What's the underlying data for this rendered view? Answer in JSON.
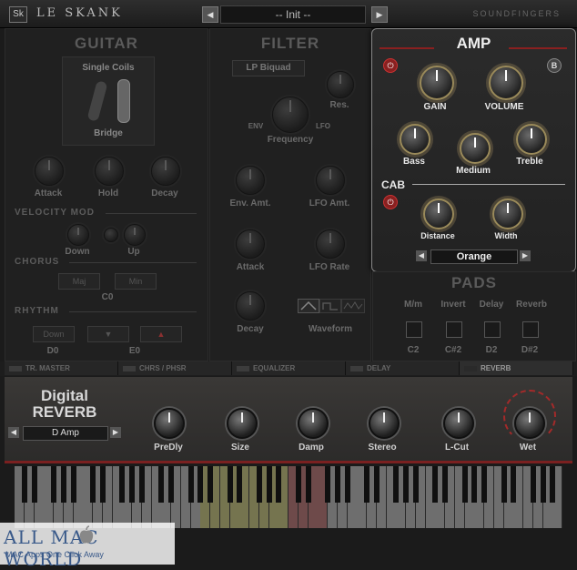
{
  "header": {
    "logo": "Sk",
    "title": "LE SKANK",
    "prev": "◀",
    "next": "▶",
    "preset": "-- Init --",
    "brand": "SOUNDFINGERS"
  },
  "guitar": {
    "title": "GUITAR",
    "pickup": "Single Coils",
    "position": "Bridge",
    "knobs": [
      "Attack",
      "Hold",
      "Decay"
    ],
    "velocity_label": "VELOCITY MOD",
    "velocity_knobs": [
      "Down",
      "Up"
    ],
    "chorus_label": "CHORUS",
    "chorus_buttons": [
      "Maj",
      "Min"
    ],
    "chorus_note": "C0",
    "rhythm_label": "RHYTHM",
    "rhythm_buttons": [
      "Down",
      "▼",
      "▲"
    ],
    "rhythm_notes": [
      "D0",
      "E0"
    ]
  },
  "filter": {
    "title": "FILTER",
    "type": "LP Biquad",
    "res_label": "Res.",
    "freq_label": "Frequency",
    "env_label": "ENV",
    "lfo_label": "LFO",
    "env_amt": "Env. Amt.",
    "lfo_amt": "LFO Amt.",
    "attack": "Attack",
    "lfo_rate": "LFO Rate",
    "decay": "Decay",
    "waveform": "Waveform"
  },
  "amp": {
    "title": "AMP",
    "b_button": "B",
    "knobs_top": [
      "GAIN",
      "VOLUME"
    ],
    "knobs_eq": [
      "Bass",
      "Medium",
      "Treble"
    ],
    "cab_label": "CAB",
    "cab_knobs": [
      "Distance",
      "Width"
    ],
    "cab_model": "Orange",
    "prev": "◀",
    "next": "▶"
  },
  "pads": {
    "title": "PADS",
    "labels": [
      "M/m",
      "Invert",
      "Delay",
      "Reverb"
    ],
    "notes": [
      "C2",
      "C#2",
      "D2",
      "D#2"
    ]
  },
  "fx_tabs": [
    "TR. MASTER",
    "CHRS / PHSR",
    "EQUALIZER",
    "DELAY",
    "REVERB"
  ],
  "reverb": {
    "title_line1": "Digital",
    "title_line2": "REVERB",
    "preset": "D Amp",
    "prev": "◀",
    "next": "▶",
    "knobs": [
      "PreDly",
      "Size",
      "Damp",
      "Stereo",
      "L-Cut",
      "Wet"
    ]
  },
  "watermark": {
    "brand": "ALL MAC WORLD",
    "tagline": "MAC Apps One Click Away"
  }
}
